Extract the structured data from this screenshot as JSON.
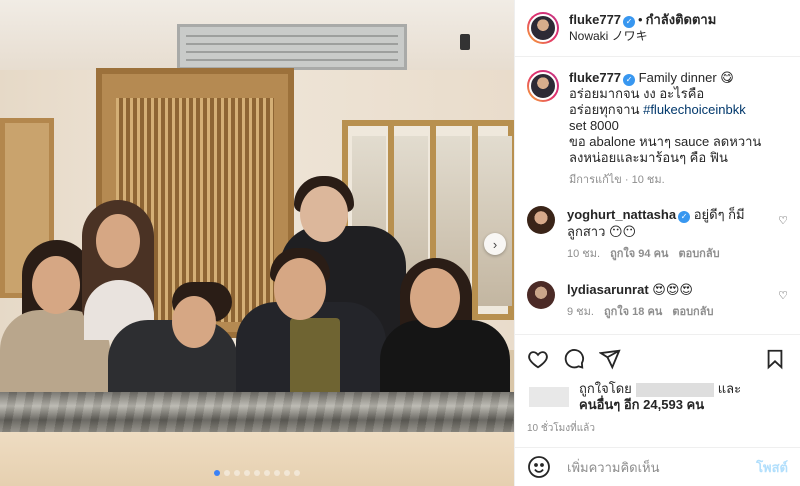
{
  "header": {
    "username": "fluke777",
    "separator": "•",
    "follow_label": "กำลังติดตาม",
    "location": "Nowaki ノワキ"
  },
  "caption": {
    "username": "fluke777",
    "lines": [
      "Family dinner 😋",
      "อร่อยมากจน งง อะไรคือ",
      "อร่อยทุกจาน",
      "set 8000",
      "ขอ abalone หนาๆ sauce ลดหวาน",
      "ลงหน่อยและมาร้อนๆ คือ ฟิน"
    ],
    "hashtag": "#flukechoiceinbkk",
    "meta": "มีการแก้ไข · 10 ชม."
  },
  "comments": [
    {
      "username": "yoghurt_nattasha",
      "text": "อยู่ดีๆ ก็มีลูกสาว 😶😶",
      "time": "10 ชม.",
      "likes": "ถูกใจ 94 คน",
      "reply": "ตอบกลับ"
    },
    {
      "username": "lydiasarunrat",
      "text": "😍😍😍",
      "time": "9 ชม.",
      "likes": "ถูกใจ 18 คน",
      "reply": "ตอบกลับ"
    }
  ],
  "likes": {
    "liked_by": "ถูกใจโดย",
    "and": "และ",
    "others": "คนอื่นๆ อีก 24,593 คน"
  },
  "time_ago": "10 ชั่วโมงที่แล้ว",
  "add_comment": {
    "placeholder": "เพิ่มความคิดเห็น",
    "post_label": "โพสต์"
  },
  "icons": {
    "verified": "✓",
    "next": "›",
    "heart_small": "♡"
  },
  "carousel": {
    "count": 9,
    "active": 1
  }
}
